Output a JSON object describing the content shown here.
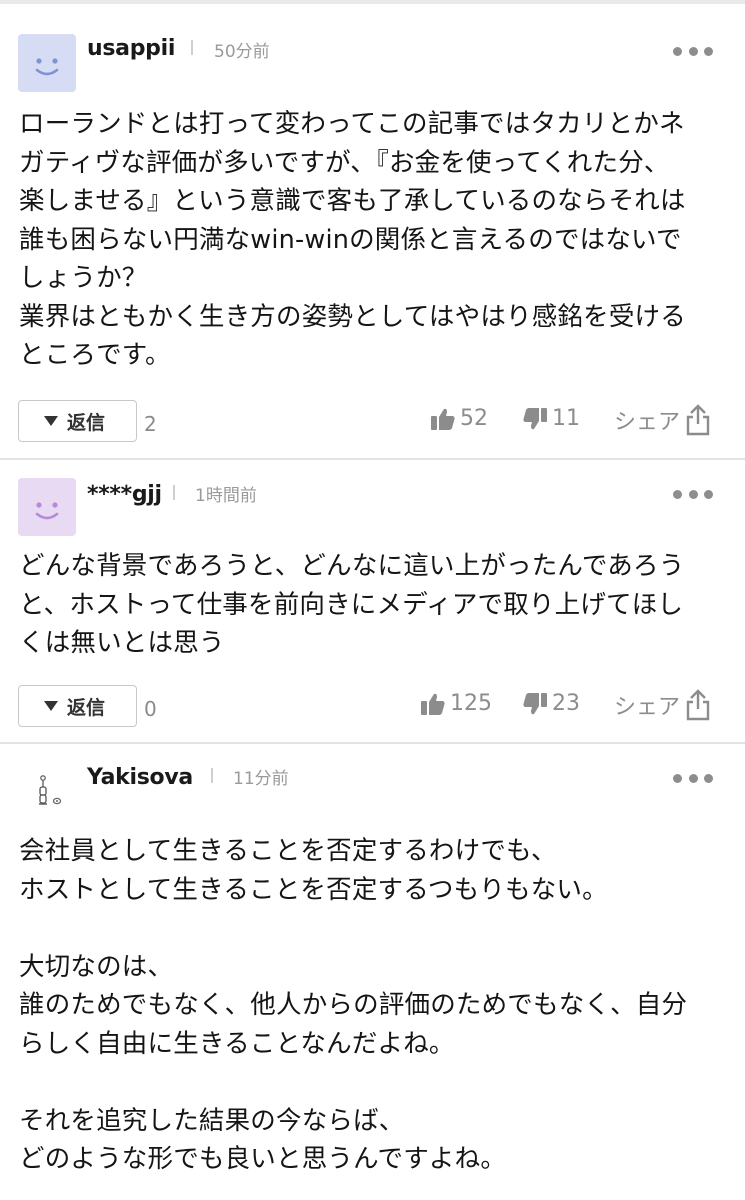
{
  "reply_label": "返信",
  "share_label": "シェア",
  "comments": [
    {
      "username": "usappii",
      "time": "50分前",
      "avatar_color": "#d6dcf3",
      "face_color": "#7e93d3",
      "text": "ローランドとは打って変わってこの記事ではタカリとかネ\nガティヴな評価が多いですが、『お金を使ってくれた分、\n楽しませる』という意識で客も了承しているのならそれは\n誰も困らない円満なwin-winの関係と言えるのではないで\nしょうか？\n業界はともかく生き方の姿勢としてはやはり感銘を受ける\nところです。",
      "replies": "2",
      "likes": "52",
      "dislikes": "11"
    },
    {
      "username": "****gjj",
      "time": "1時間前",
      "avatar_color": "#e8daf2",
      "face_color": "#b58ad8",
      "text": "どんな背景であろうと、どんなに這い上がったんであろう\nと、ホストって仕事を前向きにメディアで取り上げてほし\nくは無いとは思う",
      "replies": "0",
      "likes": "125",
      "dislikes": "23"
    },
    {
      "username": "Yakisova",
      "time": "11分前",
      "text": "会社員として生きることを否定するわけでも、\nホストとして生きることを否定するつもりもない。\n\n大切なのは、\n誰のためでもなく、他人からの評価のためでもなく、自分\nらしく自由に生きることなんだよね。\n\nそれを追究した結果の今ならば、\nどのような形でも良いと思うんですよね。"
    }
  ],
  "colors": {
    "separator": "#e3e3e3",
    "muted_text": "#8c8c8c",
    "body_text": "#151515"
  }
}
